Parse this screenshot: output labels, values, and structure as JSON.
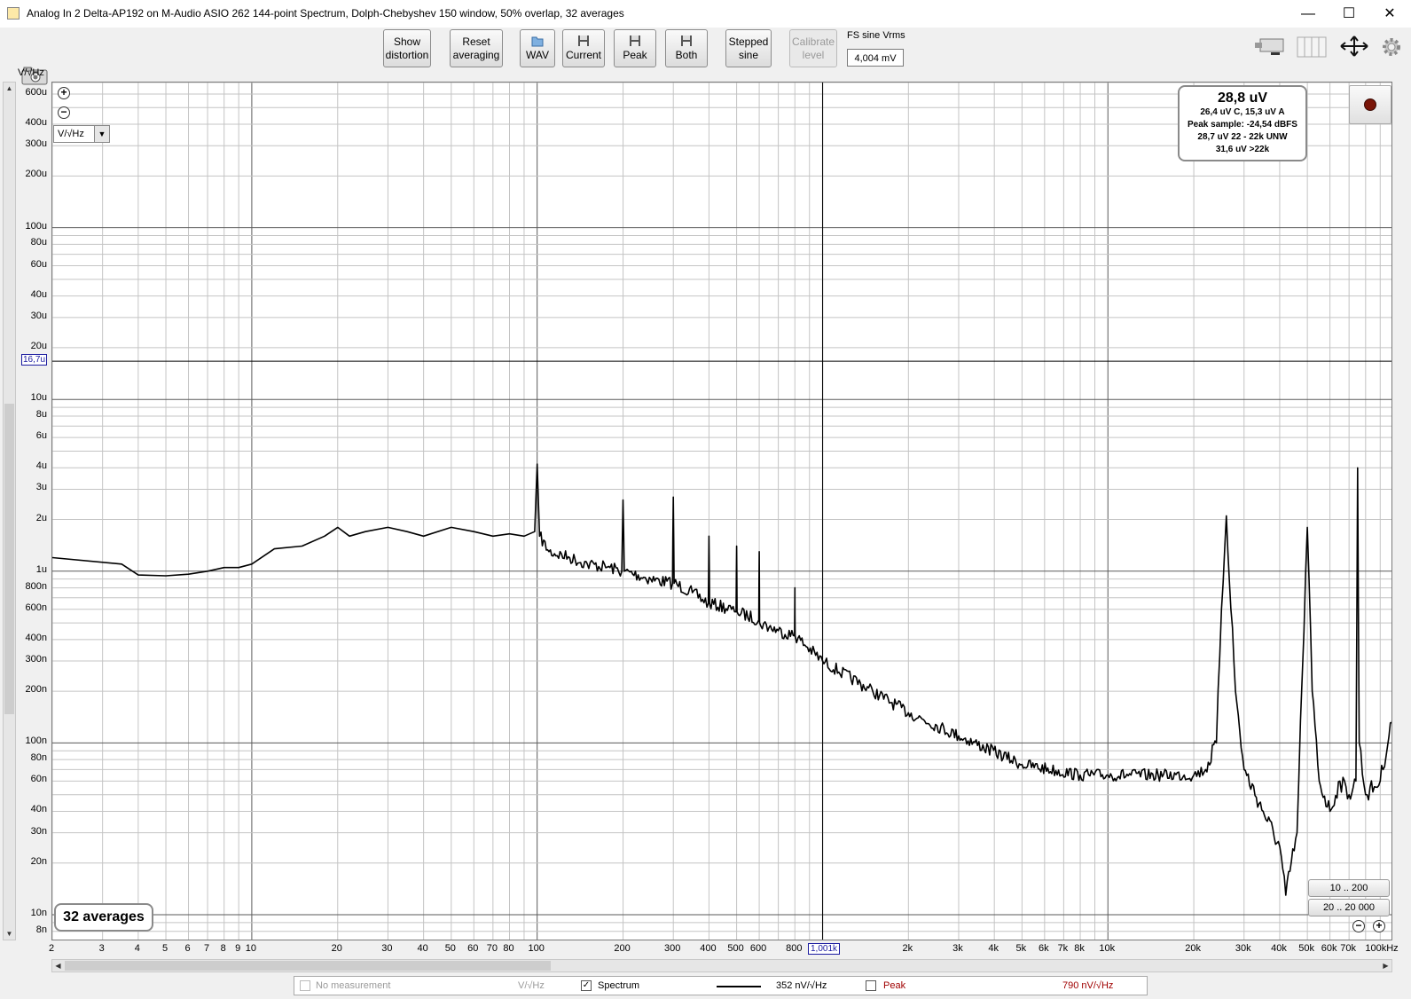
{
  "window": {
    "title": "Analog In 2 Delta-AP192 on M-Audio ASIO 262 144-point Spectrum, Dolph-Chebyshev 150 window, 50% overlap, 32 averages",
    "minimize_icon": "minimize-icon",
    "maximize_icon": "maximize-icon",
    "close_icon": "close-icon"
  },
  "toolbar": {
    "show_distortion": [
      "Show",
      "distortion"
    ],
    "reset_averaging": [
      "Reset",
      "averaging"
    ],
    "wav": "WAV",
    "current": "Current",
    "peak": "Peak",
    "both": "Both",
    "stepped_sine": [
      "Stepped",
      "sine"
    ],
    "calibrate_level": [
      "Calibrate",
      "level"
    ],
    "fs_sine_label": "FS sine Vrms",
    "fs_sine_value": "4,004 mV"
  },
  "axis": {
    "y_unit": "V/√Hz",
    "y_ticks": [
      "600u",
      "400u",
      "300u",
      "200u",
      "100u",
      "80u",
      "60u",
      "40u",
      "30u",
      "20u",
      "10u",
      "8u",
      "6u",
      "4u",
      "3u",
      "2u",
      "1u",
      "800n",
      "600n",
      "400n",
      "300n",
      "200n",
      "100n",
      "80n",
      "60n",
      "40n",
      "30n",
      "20n",
      "10n",
      "8n"
    ],
    "x_ticks": [
      "2",
      "3",
      "4",
      "5",
      "6",
      "7",
      "8",
      "9",
      "10",
      "20",
      "30",
      "40",
      "50",
      "60",
      "70",
      "80",
      "100",
      "200",
      "300",
      "400",
      "500",
      "600",
      "800",
      "2k",
      "3k",
      "4k",
      "5k",
      "6k",
      "7k",
      "8k",
      "10k",
      "20k",
      "30k",
      "40k",
      "50k",
      "60k",
      "70k",
      "100kHz"
    ]
  },
  "cursor": {
    "y_value": "16,7u",
    "x_value": "1,001k"
  },
  "unit_selector": "V/√Hz",
  "readout": {
    "main": "28,8 uV",
    "line1": "26,4 uV C, 15,3 uV A",
    "line2": "Peak sample: -24,54 dBFS",
    "line3": "28,7 uV 22 - 22k UNW",
    "line4": "31,6 uV >22k"
  },
  "averages_label": "32 averages",
  "range_buttons": [
    "10 .. 200",
    "20 .. 20 000"
  ],
  "legend": {
    "no_measurement": "No measurement",
    "no_measurement_unit": "V/√Hz",
    "spectrum": "Spectrum",
    "spectrum_value": "352 nV/√Hz",
    "peak": "Peak",
    "peak_value": "790 nV/√Hz",
    "peak_color": "#a00000"
  },
  "chart_data": {
    "type": "line",
    "x_scale": "log",
    "y_scale": "log",
    "xlim": [
      2,
      100000
    ],
    "ylim": [
      7e-09,
      0.0007
    ],
    "ylabel": "V/√Hz",
    "grid": true,
    "series": [
      {
        "name": "Spectrum",
        "color": "#000000",
        "x": [
          2,
          3.5,
          4,
          5,
          6,
          7,
          8,
          9,
          10,
          12,
          15,
          18,
          20,
          22,
          25,
          30,
          35,
          40,
          50,
          60,
          70,
          80,
          90,
          98,
          100,
          102,
          110,
          130,
          150,
          180,
          198,
          200,
          202,
          250,
          298,
          300,
          302,
          350,
          398,
          400,
          402,
          480,
          498,
          500,
          502,
          598,
          600,
          602,
          700,
          798,
          800,
          802,
          1000,
          1500,
          2000,
          3000,
          5000,
          8000,
          10000,
          15000,
          20000,
          22000,
          24000,
          25000,
          26000,
          28000,
          30000,
          35000,
          40000,
          42000,
          46000,
          48000,
          50000,
          52000,
          55000,
          60000,
          65000,
          70000,
          74000,
          75000,
          76000,
          80000,
          90000,
          100000
        ],
        "y": [
          1.2e-06,
          1.1e-06,
          9.5e-07,
          9.4e-07,
          9.6e-07,
          1e-06,
          1.05e-06,
          1.05e-06,
          1.1e-06,
          1.35e-06,
          1.4e-06,
          1.6e-06,
          1.8e-06,
          1.6e-06,
          1.7e-06,
          1.8e-06,
          1.7e-06,
          1.6e-06,
          1.8e-06,
          1.7e-06,
          1.6e-06,
          1.65e-06,
          1.6e-06,
          1.7e-06,
          4.2e-06,
          1.6e-06,
          1.3e-06,
          1.2e-06,
          1.1e-06,
          1.05e-06,
          1e-06,
          2.6e-06,
          1e-06,
          9e-07,
          8.5e-07,
          2.7e-06,
          8.5e-07,
          7.5e-07,
          6.5e-07,
          1.6e-06,
          6.5e-07,
          6e-07,
          5.8e-07,
          1.4e-06,
          5.8e-07,
          5.2e-07,
          1.3e-06,
          5e-07,
          4.5e-07,
          4.2e-07,
          8e-07,
          4.2e-07,
          3e-07,
          2e-07,
          1.5e-07,
          1.1e-07,
          7.5e-08,
          6.5e-08,
          6.5e-08,
          6.5e-08,
          6.5e-08,
          7e-08,
          1e-07,
          6e-07,
          2.1e-06,
          2e-07,
          7e-08,
          4e-08,
          2.5e-08,
          1.3e-08,
          3e-08,
          2.5e-07,
          1.8e-06,
          2e-07,
          6e-08,
          4e-08,
          6e-08,
          5e-08,
          6e-08,
          4e-06,
          1e-07,
          5e-08,
          6e-08,
          1.5e-07
        ]
      }
    ]
  }
}
